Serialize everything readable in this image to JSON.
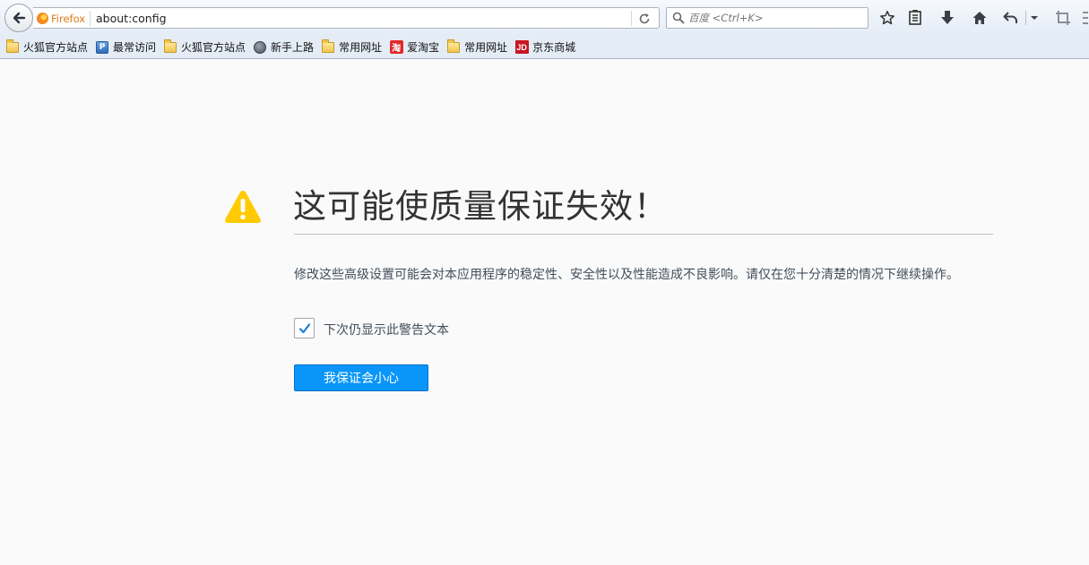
{
  "toolbar": {
    "identity_label": "Firefox",
    "url": "about:config",
    "search_placeholder": "百度 <Ctrl+K>"
  },
  "bookmarks": [
    {
      "label": "火狐官方站点",
      "icon": "folder-icon"
    },
    {
      "label": "最常访问",
      "icon": "most-visited-icon"
    },
    {
      "label": "火狐官方站点",
      "icon": "folder-icon"
    },
    {
      "label": "新手上路",
      "icon": "globe-icon"
    },
    {
      "label": "常用网址",
      "icon": "folder-icon"
    },
    {
      "label": "爱淘宝",
      "icon": "taobao-icon",
      "glyph": "淘"
    },
    {
      "label": "常用网址",
      "icon": "folder-icon"
    },
    {
      "label": "京东商城",
      "icon": "jd-icon",
      "glyph": "JD"
    }
  ],
  "warning": {
    "title": "这可能使质量保证失效！",
    "description": "修改这些高级设置可能会对本应用程序的稳定性、安全性以及性能造成不良影响。请仅在您十分清楚的情况下继续操作。",
    "checkbox_label": "下次仍显示此警告文本",
    "checkbox_checked": true,
    "button_label": "我保证会小心"
  },
  "colors": {
    "accent": "#0996f8",
    "warning": "#ffcb00",
    "text": "#424e5a"
  }
}
